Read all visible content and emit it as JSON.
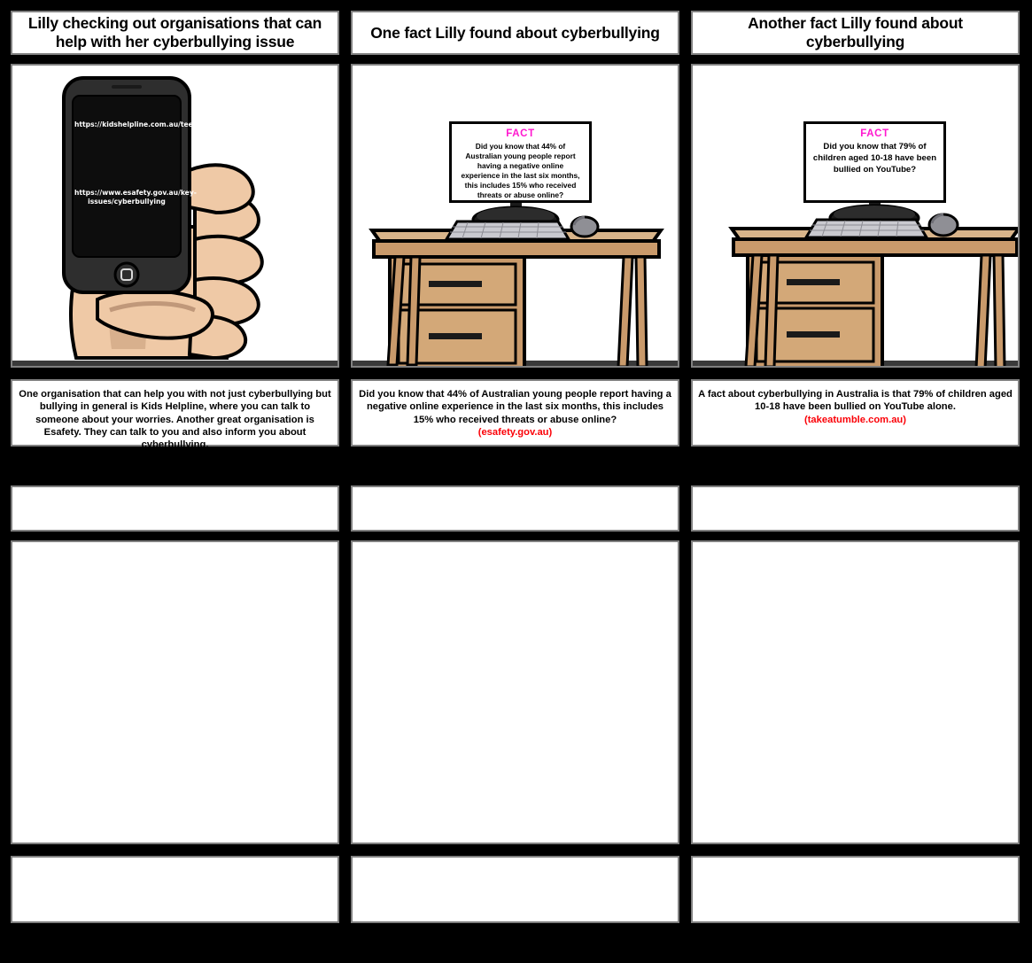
{
  "storyboard": {
    "background_color": "#000000",
    "cell_border_color": "#808080",
    "accent_magenta": "#ff18cf",
    "citation_red": "#fb0007",
    "skin_light": "#efc9a6",
    "skin_shadow": "#c0987a",
    "desk_wood": "#c99a6b",
    "desk_wood_light": "#d8b48a",
    "phone_body": "#2b2b2b",
    "phone_screen": "#0d0d0d",
    "keyboard_gray": "#c9c9cf",
    "mouse_gray": "#8f8f95"
  },
  "panels": [
    {
      "id": "panel-1",
      "title": "Lilly checking out organisations that can help with her cyberbullying issue",
      "art": "hand-holding-phone",
      "phone": {
        "url_top": "https://kidshelpline.com.au/teens/issues/bullying",
        "url_bottom": "https://www.esafety.gov.au/key-issues/cyberbullying"
      },
      "caption": "One organisation that can help you with not just cyberbullying but bullying in general is Kids Helpline, where you can talk to someone about your worries. Another great organisation is Esafety. They can talk to you and also inform you about cyberbullying.",
      "citation": ""
    },
    {
      "id": "panel-2",
      "title": "One fact Lilly found about cyberbullying",
      "art": "desk-with-monitor",
      "monitor": {
        "heading": "FACT",
        "body": "Did you know that 44% of Australian young people report having a negative online experience in the last six months, this includes 15% who received threats or abuse online?"
      },
      "caption": "Did you know that 44% of Australian young people report having a negative online experience in the last six months, this includes 15% who received threats or abuse online?",
      "citation": "(esafety.gov.au)"
    },
    {
      "id": "panel-3",
      "title": "Another fact Lilly found about cyberbullying",
      "art": "desk-with-monitor",
      "monitor": {
        "heading": "FACT",
        "body": "Did you know that 79% of children aged 10-18 have been bullied on YouTube?"
      },
      "caption": "A fact about cyberbullying in Australia is that 79% of children aged 10-18 have been bullied on YouTube alone.",
      "citation": "(takeatumble.com.au)"
    }
  ],
  "empty_rows": {
    "row2_titles": [
      "",
      "",
      ""
    ],
    "row2_art": [
      "",
      "",
      ""
    ],
    "row3_captions": [
      "",
      "",
      ""
    ]
  }
}
